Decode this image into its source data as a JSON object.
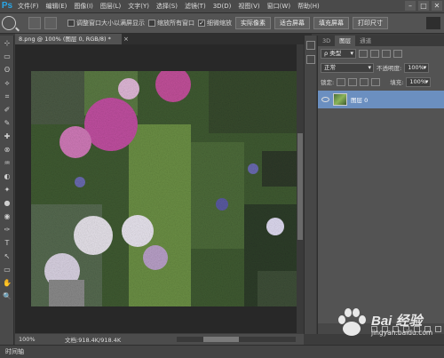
{
  "app": {
    "logo": "Ps"
  },
  "menu": [
    "文件(F)",
    "编辑(E)",
    "图像(I)",
    "图层(L)",
    "文字(Y)",
    "选择(S)",
    "滤镜(T)",
    "3D(D)",
    "视图(V)",
    "窗口(W)",
    "帮助(H)"
  ],
  "window_controls": [
    "–",
    "□",
    "✕"
  ],
  "options": {
    "check_resize": "调整窗口大小以满屏显示",
    "check_zoom_all": "缩放所有窗口",
    "check_scrubby": "细微缩放",
    "btn_actual": "实际像素",
    "btn_fit": "适合屏幕",
    "btn_fill": "填充屏幕",
    "btn_print": "打印尺寸"
  },
  "tools": [
    "⊹",
    "▭",
    "ʘ",
    "⟡",
    "⌗",
    "✐",
    "✎",
    "✚",
    "⊗",
    "♒",
    "◐",
    "✦",
    "●",
    "◉",
    "✑",
    "T",
    "↖",
    "▭",
    "✋",
    "🔍"
  ],
  "document": {
    "tab_title": "8.png @ 100% (图层 0, RGB/8) *",
    "tab_close": "×"
  },
  "status": {
    "zoom": "100%",
    "doc_size": "文档:918.4K/918.4K"
  },
  "timeline": "时间轴",
  "layers_panel": {
    "tabs": [
      "3D",
      "图层",
      "通道"
    ],
    "filter_label": "ρ 类型",
    "blend_mode": "正常",
    "opacity_label": "不透明度:",
    "opacity_value": "100%",
    "lock_label": "锁定:",
    "fill_label": "填充:",
    "fill_value": "100%",
    "layer_name": "图层 0"
  },
  "watermark": {
    "brand": "Bai 经验",
    "url": "jingyan.baidu.com"
  },
  "colors": {
    "accent": "#29a6e6",
    "layer_selected": "#6b8fc0",
    "panel": "#535353"
  }
}
